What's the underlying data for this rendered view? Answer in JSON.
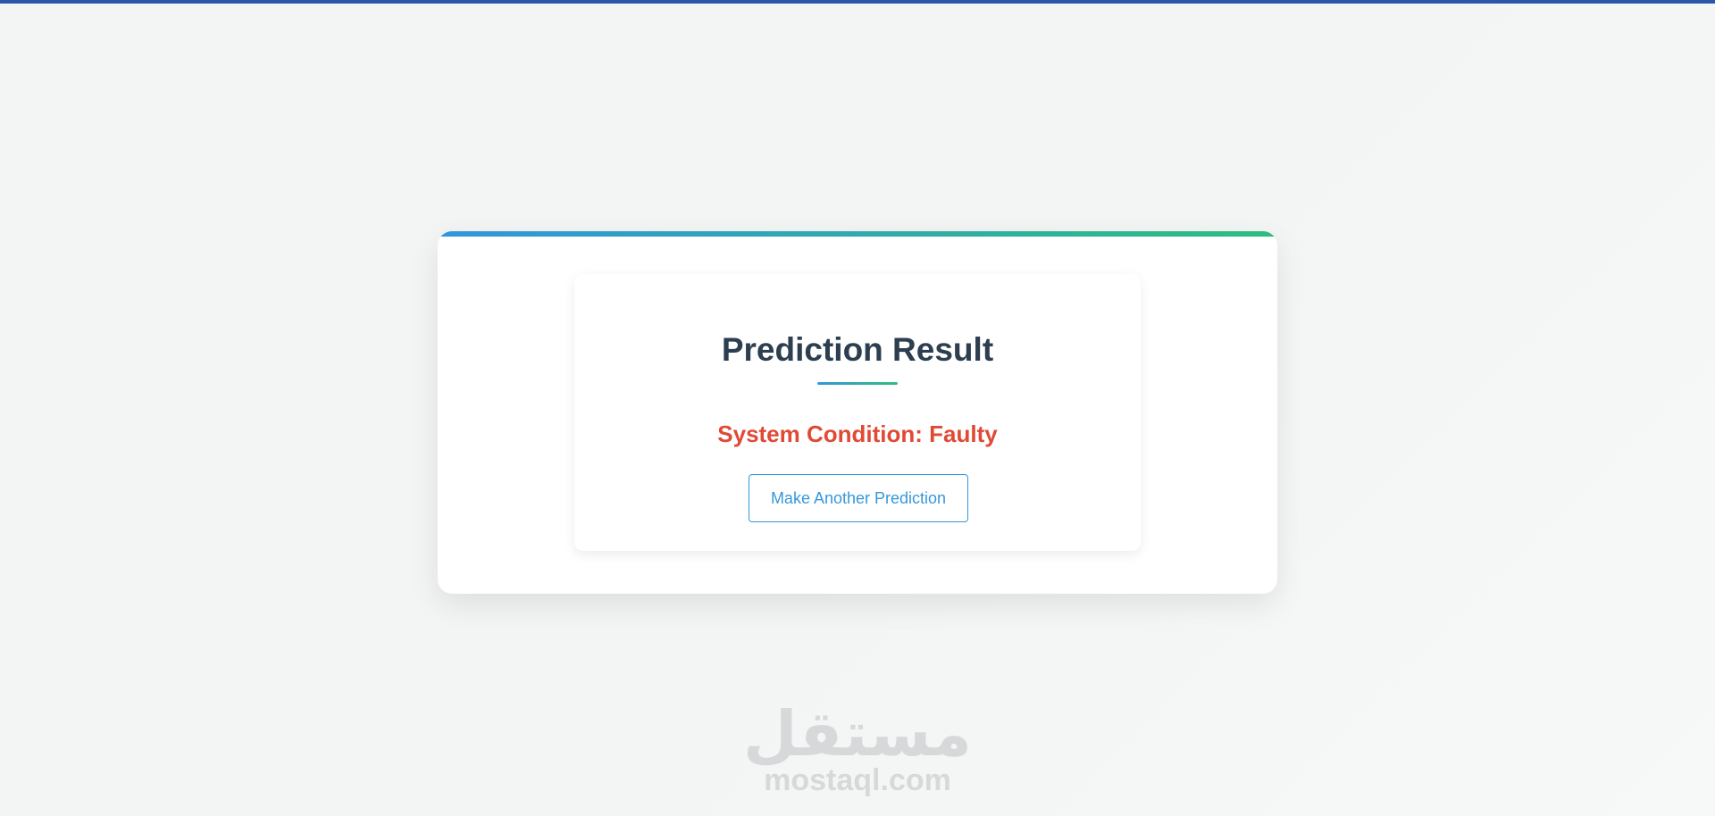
{
  "colors": {
    "top_bar": "#2c57a8",
    "accent_start": "#3296dc",
    "accent_end": "#2ebd7f",
    "title": "#2c3e50",
    "result_faulty": "#e04a35",
    "button": "#3498db",
    "background": "#f3f5f5"
  },
  "result": {
    "title": "Prediction Result",
    "condition_text": "System Condition: Faulty"
  },
  "actions": {
    "again_label": "Make Another Prediction"
  },
  "watermark": {
    "arabic": "مستقل",
    "latin": "mostaql.com"
  }
}
